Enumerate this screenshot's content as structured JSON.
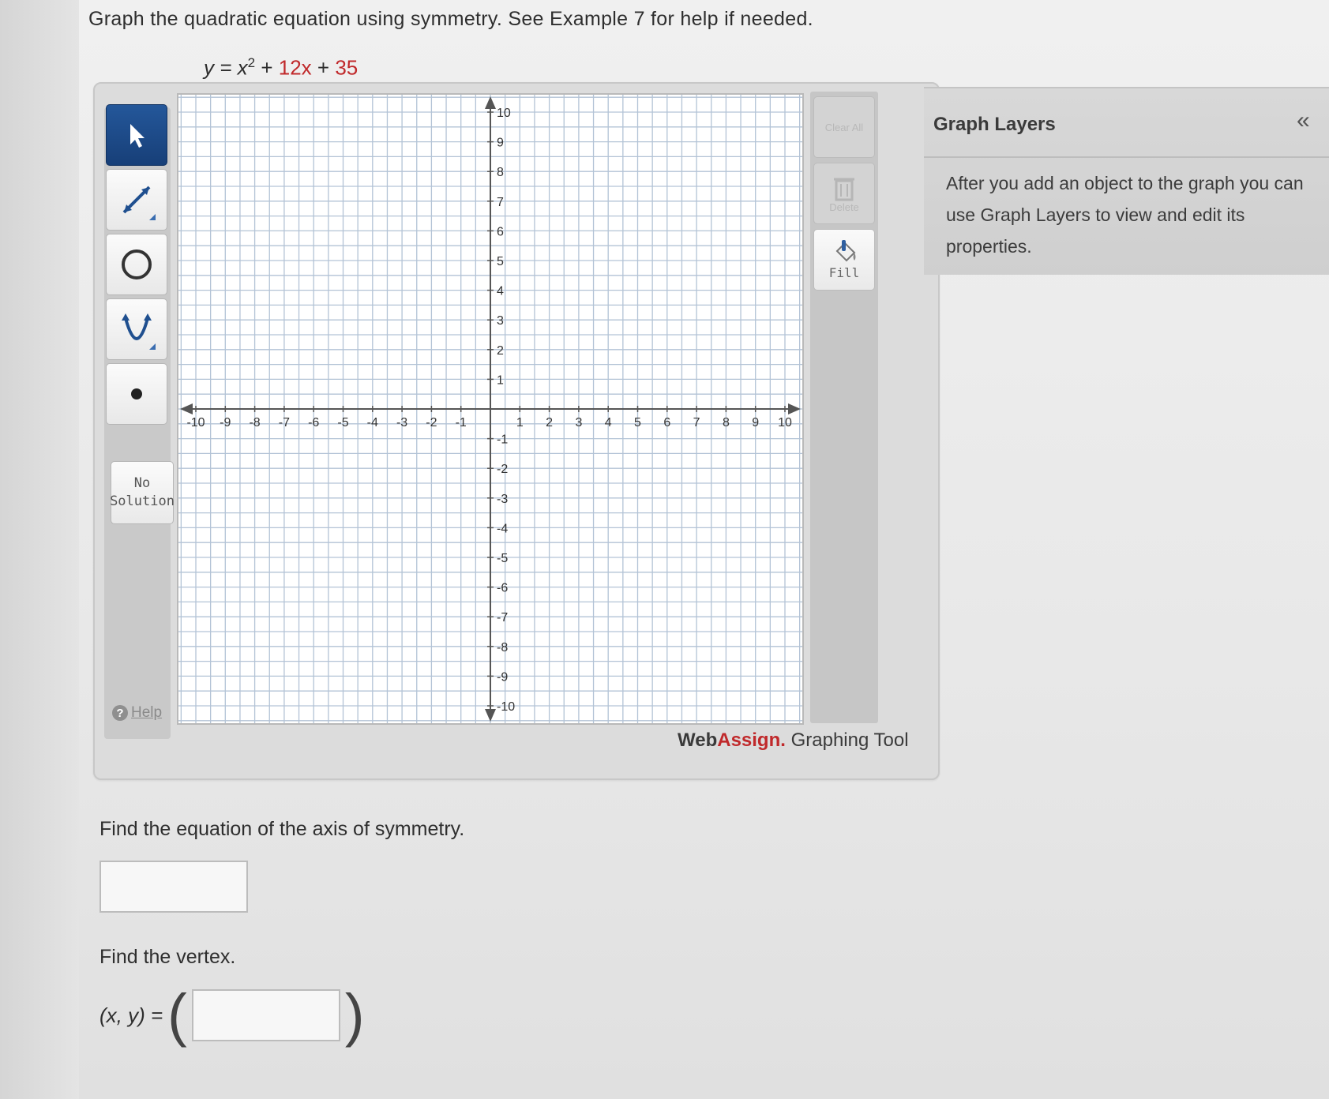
{
  "question": {
    "prompt": "Graph the quadratic equation using symmetry. See Example 7 for help if needed.",
    "equation": {
      "lhs": "y = ",
      "x_base": "x",
      "x_exp": "2",
      "term_sign1": " + ",
      "term2": "12x",
      "term_sign2": " + ",
      "term3": "35"
    }
  },
  "toolbar": {
    "tools": [
      "pointer-tool",
      "line-tool",
      "circle-tool",
      "parabola-tool",
      "point-tool"
    ],
    "no_solution_line1": "No",
    "no_solution_line2": "Solution",
    "help_label": "Help"
  },
  "side_actions": {
    "clear_all": "Clear All",
    "delete": "Delete",
    "fill": "Fill"
  },
  "brand": {
    "web": "Web",
    "assign": "Assign.",
    "tool_name": " Graphing Tool"
  },
  "graph": {
    "xmin": -10,
    "xmax": 10,
    "ymin": -10,
    "ymax": 10,
    "x_ticks": [
      "-10",
      "-9",
      "-8",
      "-7",
      "-6",
      "-5",
      "-4",
      "-3",
      "-2",
      "-1",
      "1",
      "2",
      "3",
      "4",
      "5",
      "6",
      "7",
      "8",
      "9",
      "10"
    ],
    "y_ticks": [
      "10",
      "9",
      "8",
      "7",
      "6",
      "5",
      "4",
      "3",
      "2",
      "1",
      "-1",
      "-2",
      "-3",
      "-4",
      "-5",
      "-6",
      "-7",
      "-8",
      "-9",
      "-10"
    ],
    "minor_grid_per_unit": 1,
    "grid": true
  },
  "layers_panel": {
    "title": "Graph Layers",
    "collapse_glyph": "«",
    "body": "After you add an object to the graph you can use Graph Layers to view and edit its properties."
  },
  "part1": {
    "label": "Find the equation of the axis of symmetry.",
    "value": ""
  },
  "part2": {
    "label": "Find the vertex.",
    "xy_label": "(x, y) = ",
    "open_paren": "(",
    "close_paren": ")",
    "value": ""
  }
}
